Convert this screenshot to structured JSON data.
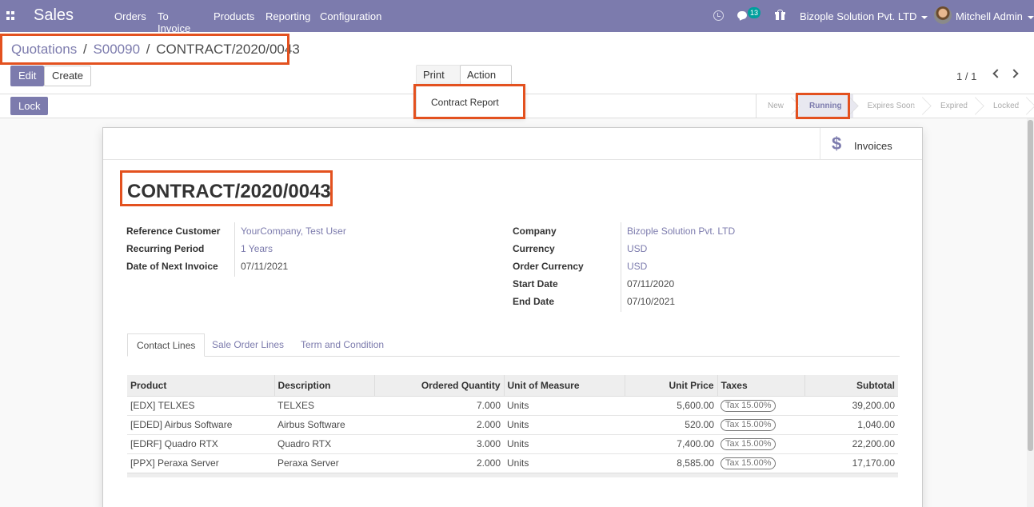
{
  "navbar": {
    "app_name": "Sales",
    "menu": [
      "Orders",
      "To Invoice",
      "Products",
      "Reporting",
      "Configuration"
    ],
    "notification_count": "13",
    "company": "Bizople Solution Pvt. LTD",
    "user": "Mitchell Admin"
  },
  "breadcrumb": {
    "root": "Quotations",
    "sep1": "/",
    "parent": "S00090",
    "sep2": "/",
    "current": "CONTRACT/2020/0043"
  },
  "toolbar": {
    "edit": "Edit",
    "create": "Create",
    "print": "Print",
    "action": "Action",
    "print_menu_item": "Contract Report",
    "pager": "1 / 1",
    "lock": "Lock"
  },
  "status": {
    "stages": [
      "New",
      "Running",
      "Expires Soon",
      "Expired",
      "Locked"
    ],
    "active": "Running"
  },
  "smart_button": {
    "label": "Invoices",
    "icon": "dollar-icon"
  },
  "record": {
    "title": "CONTRACT/2020/0043",
    "left_fields": [
      {
        "label": "Reference Customer",
        "value": "YourCompany, Test User"
      },
      {
        "label": "Recurring Period",
        "value": "1 Years"
      },
      {
        "label": "Date of Next Invoice",
        "value": "07/11/2021"
      }
    ],
    "right_fields": [
      {
        "label": "Company",
        "value": "Bizople Solution Pvt. LTD"
      },
      {
        "label": "Currency",
        "value": "USD"
      },
      {
        "label": "Order Currency",
        "value": "USD"
      },
      {
        "label": "Start Date",
        "value": "07/11/2020"
      },
      {
        "label": "End Date",
        "value": "07/10/2021"
      }
    ]
  },
  "tabs": [
    "Contact Lines",
    "Sale Order Lines",
    "Term and Condition"
  ],
  "lines": {
    "headers": [
      "Product",
      "Description",
      "Ordered Quantity",
      "Unit of Measure",
      "Unit Price",
      "Taxes",
      "Subtotal"
    ],
    "rows": [
      {
        "product": "[EDX] TELXES",
        "description": "TELXES",
        "qty": "7.000",
        "uom": "Units",
        "price": "5,600.00",
        "tax": "Tax 15.00%",
        "subtotal": "39,200.00"
      },
      {
        "product": "[EDED] Airbus Software",
        "description": "Airbus Software",
        "qty": "2.000",
        "uom": "Units",
        "price": "520.00",
        "tax": "Tax 15.00%",
        "subtotal": "1,040.00"
      },
      {
        "product": "[EDRF] Quadro RTX",
        "description": "Quadro RTX",
        "qty": "3.000",
        "uom": "Units",
        "price": "7,400.00",
        "tax": "Tax 15.00%",
        "subtotal": "22,200.00"
      },
      {
        "product": "[PPX] Peraxa Server",
        "description": "Peraxa Server",
        "qty": "2.000",
        "uom": "Units",
        "price": "8,585.00",
        "tax": "Tax 15.00%",
        "subtotal": "17,170.00"
      }
    ]
  },
  "colors": {
    "brand": "#7c7bad",
    "highlight": "#e3511f",
    "accent_badge": "#00a09d"
  }
}
